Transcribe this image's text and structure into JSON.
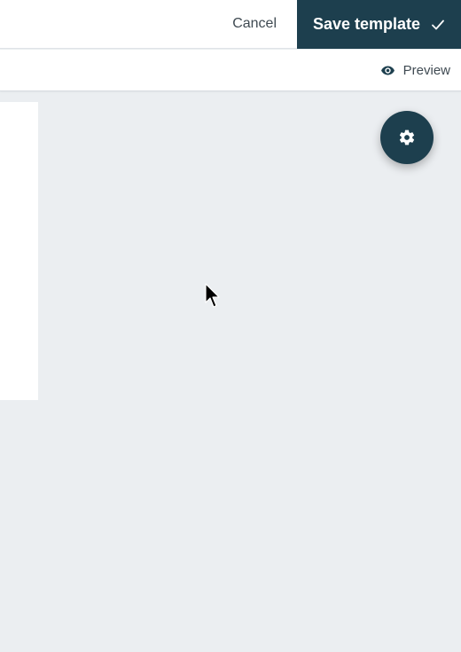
{
  "header": {
    "cancel_label": "Cancel",
    "save_label": "Save template",
    "save_icon": "check-icon"
  },
  "toolbar": {
    "preview_label": "Preview",
    "preview_icon": "eye-icon"
  },
  "fab": {
    "icon": "gear-icon"
  },
  "colors": {
    "primary": "#1d3f4e",
    "canvas_background": "#ebeef1",
    "surface": "#ffffff",
    "text": "#3f4a52"
  }
}
